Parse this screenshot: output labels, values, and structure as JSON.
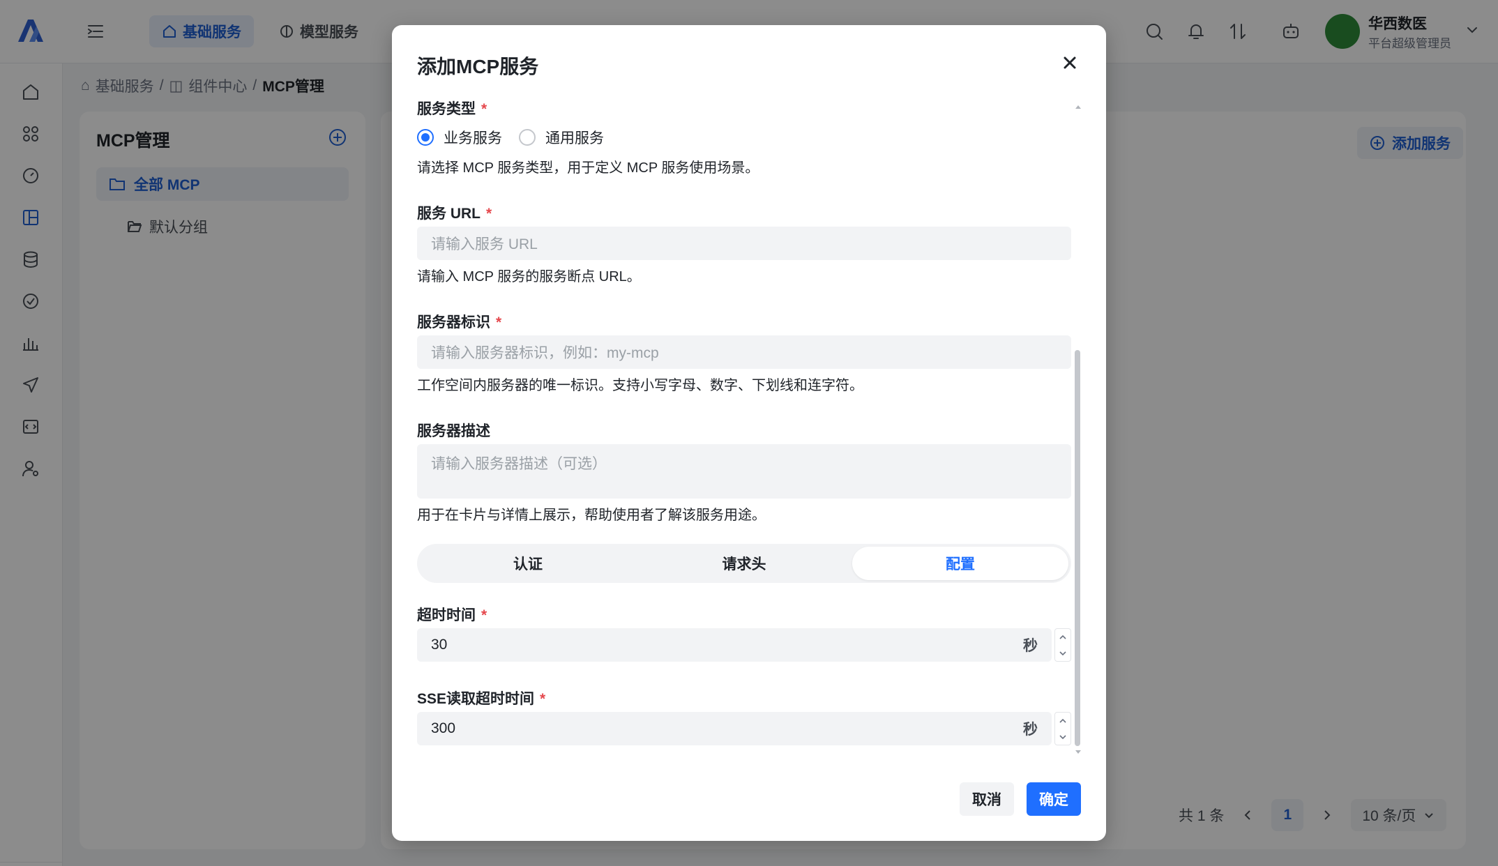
{
  "header": {
    "tabs": [
      {
        "label": "基础服务",
        "active": true
      },
      {
        "label": "模型服务",
        "active": false
      }
    ],
    "user": {
      "name": "华西数医",
      "role": "平台超级管理员"
    }
  },
  "breadcrumb": {
    "items": [
      "基础服务",
      "组件中心"
    ],
    "current": "MCP管理",
    "separator": "/"
  },
  "left_panel": {
    "title": "MCP管理",
    "tree": [
      {
        "label": "全部 MCP",
        "active": true
      },
      {
        "label": "默认分组",
        "active": false
      }
    ]
  },
  "main": {
    "add_button_label": "添加服务",
    "pager": {
      "total_text": "共 1 条",
      "current_page": "1",
      "page_size": "10 条/页"
    }
  },
  "modal": {
    "title": "添加MCP服务",
    "service_type": {
      "label": "服务类型",
      "options": [
        {
          "label": "业务服务",
          "checked": true
        },
        {
          "label": "通用服务",
          "checked": false
        }
      ],
      "help": "请选择 MCP 服务类型，用于定义 MCP 服务使用场景。"
    },
    "service_url": {
      "label": "服务 URL",
      "placeholder": "请输入服务 URL",
      "help": "请输入 MCP 服务的服务断点 URL。"
    },
    "server_id": {
      "label": "服务器标识",
      "placeholder": "请输入服务器标识，例如：my-mcp",
      "help": "工作空间内服务器的唯一标识。支持小写字母、数字、下划线和连字符。"
    },
    "server_desc": {
      "label": "服务器描述",
      "placeholder": "请输入服务器描述（可选）",
      "help": "用于在卡片与详情上展示，帮助使用者了解该服务用途。"
    },
    "tabs": [
      {
        "label": "认证",
        "active": false
      },
      {
        "label": "请求头",
        "active": false
      },
      {
        "label": "配置",
        "active": true
      }
    ],
    "timeout": {
      "label": "超时时间",
      "value": "30",
      "unit": "秒"
    },
    "sse_timeout": {
      "label": "SSE读取超时时间",
      "value": "300",
      "unit": "秒"
    },
    "required_mark": "*",
    "cancel_label": "取消",
    "confirm_label": "确定"
  },
  "colors": {
    "primary": "#1f6fff",
    "required": "#e5484d",
    "overlay": "rgba(0,0,0,0.45)"
  }
}
